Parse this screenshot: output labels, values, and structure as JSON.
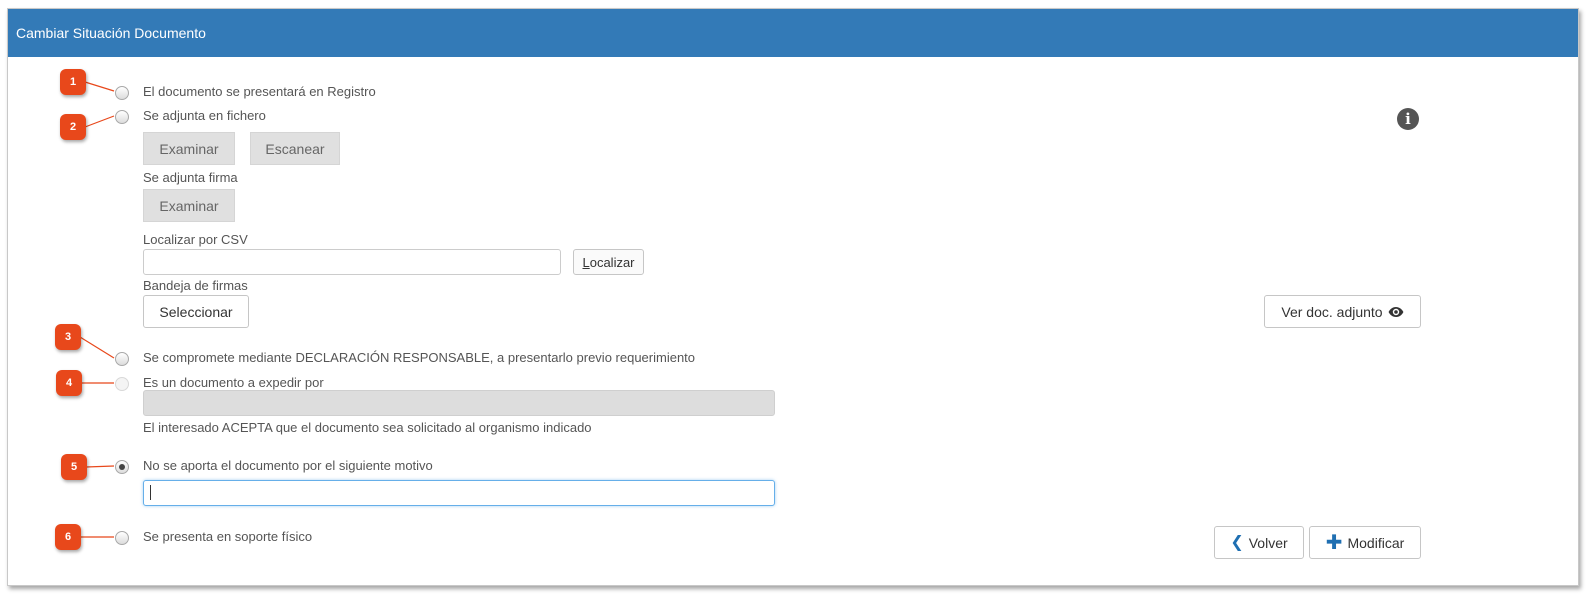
{
  "header": {
    "title": "Cambiar Situación Documento"
  },
  "options": {
    "registro": {
      "label": "El documento se presentará en Registro"
    },
    "fichero": {
      "label": "Se adjunta en fichero"
    },
    "declaracion": {
      "label": "Se compromete mediante DECLARACIÓN RESPONSABLE, a presentarlo previo requerimiento"
    },
    "expedir": {
      "label": "Es un documento a expedir por"
    },
    "no_aporta": {
      "label": "No se aporta el documento por el siguiente motivo"
    },
    "soporte_fisico": {
      "label": "Se presenta en soporte físico"
    }
  },
  "fichero": {
    "examinar_label": "Examinar",
    "escanear_label": "Escanear",
    "firma_label": "Se adjunta firma",
    "firma_examinar_label": "Examinar",
    "csv_label": "Localizar por CSV",
    "csv_value": "",
    "localizar_first": "L",
    "localizar_rest": "ocalizar",
    "bandeja_label": "Bandeja de firmas",
    "seleccionar_label": "Seleccionar",
    "ver_doc_label": "Ver doc. adjunto"
  },
  "expedir": {
    "organismo_value": "",
    "acepta_text": "El interesado ACEPTA que el documento sea solicitado al organismo indicado"
  },
  "motivo": {
    "value": ""
  },
  "actions": {
    "volver_label": "Volver",
    "modificar_label": "Modificar"
  },
  "badges": [
    "1",
    "2",
    "3",
    "4",
    "5",
    "6"
  ],
  "icons": {
    "info": "info-circle-icon",
    "eye": "eye-icon",
    "chevron": "chevron-left-icon",
    "plus": "plus-icon"
  },
  "colors": {
    "header_bg": "#337ab7",
    "badge_bg": "#e8481b",
    "accent_icon": "#1f6fb2",
    "focus_border": "#66afe9"
  }
}
